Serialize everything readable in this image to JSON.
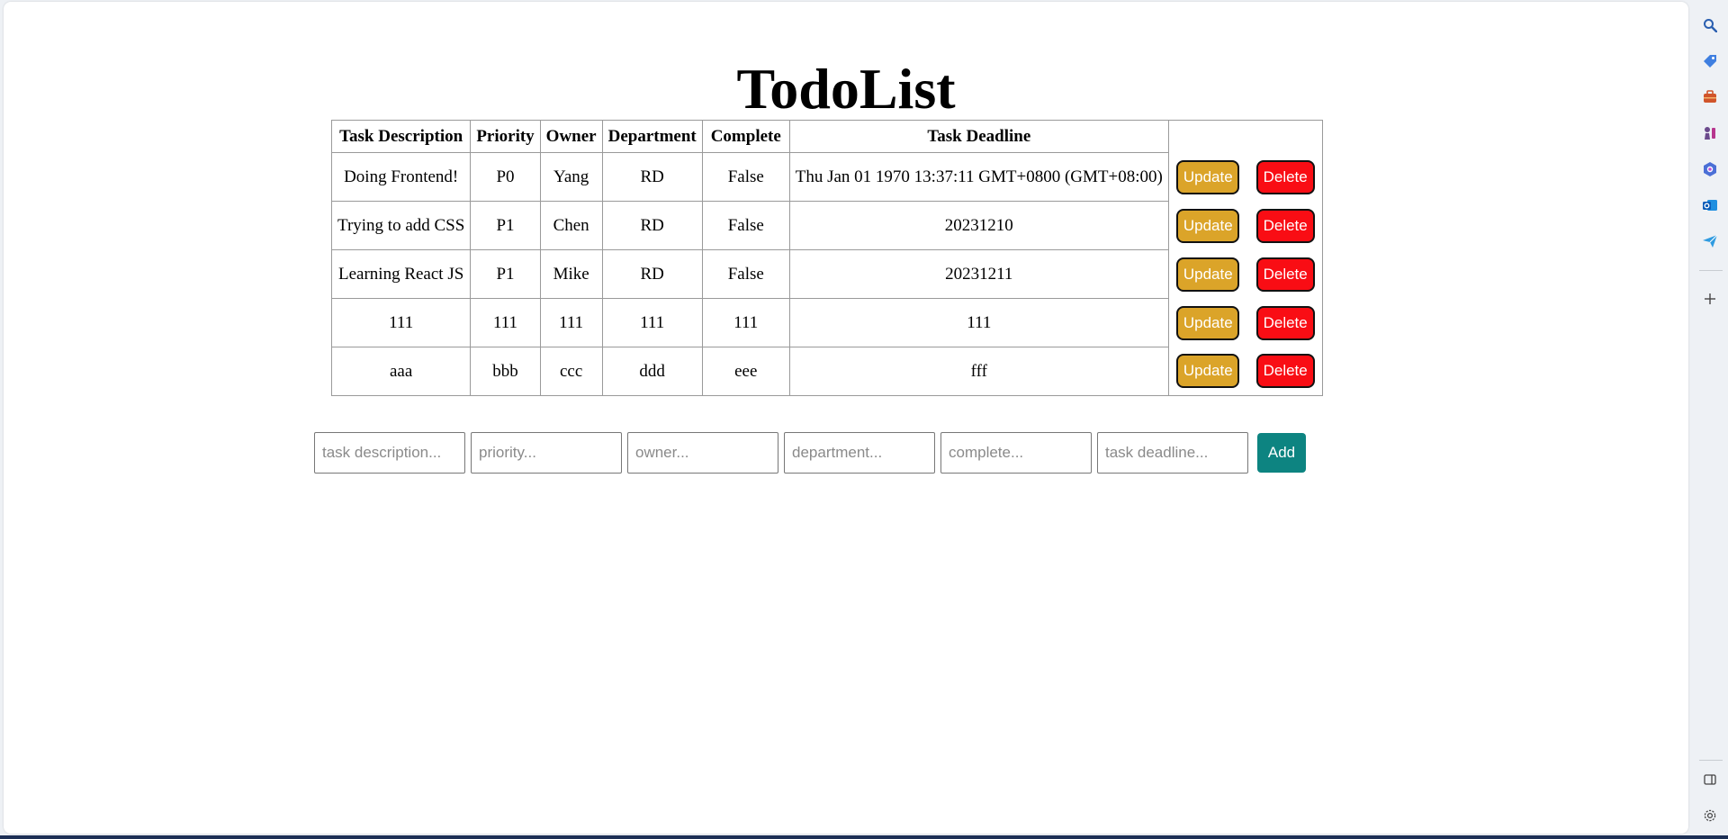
{
  "title": "TodoList",
  "table": {
    "headers": [
      "Task Description",
      "Priority",
      "Owner",
      "Department",
      "Complete",
      "Task Deadline"
    ],
    "rows": [
      [
        "Doing Frontend!",
        "P0",
        "Yang",
        "RD",
        "False",
        "Thu Jan 01 1970 13:37:11 GMT+0800 (GMT+08:00)"
      ],
      [
        "Trying to add CSS",
        "P1",
        "Chen",
        "RD",
        "False",
        "20231210"
      ],
      [
        "Learning React JS",
        "P1",
        "Mike",
        "RD",
        "False",
        "20231211"
      ],
      [
        "111",
        "111",
        "111",
        "111",
        "111",
        "111"
      ],
      [
        "aaa",
        "bbb",
        "ccc",
        "ddd",
        "eee",
        "fff"
      ]
    ],
    "update_label": "Update",
    "delete_label": "Delete"
  },
  "form": {
    "placeholders": [
      "task description...",
      "priority...",
      "owner...",
      "department...",
      "complete...",
      "task deadline..."
    ],
    "add_label": "Add"
  },
  "colors": {
    "update_button": "#dba429",
    "delete_button": "#f90d14",
    "add_button": "#0d8481"
  },
  "sidebar_icons": [
    "search-icon",
    "tag-icon",
    "briefcase-icon",
    "chess-icon",
    "copilot-icon",
    "outlook-icon",
    "send-icon",
    "plus-icon",
    "sidebar-toggle-icon",
    "settings-icon"
  ]
}
